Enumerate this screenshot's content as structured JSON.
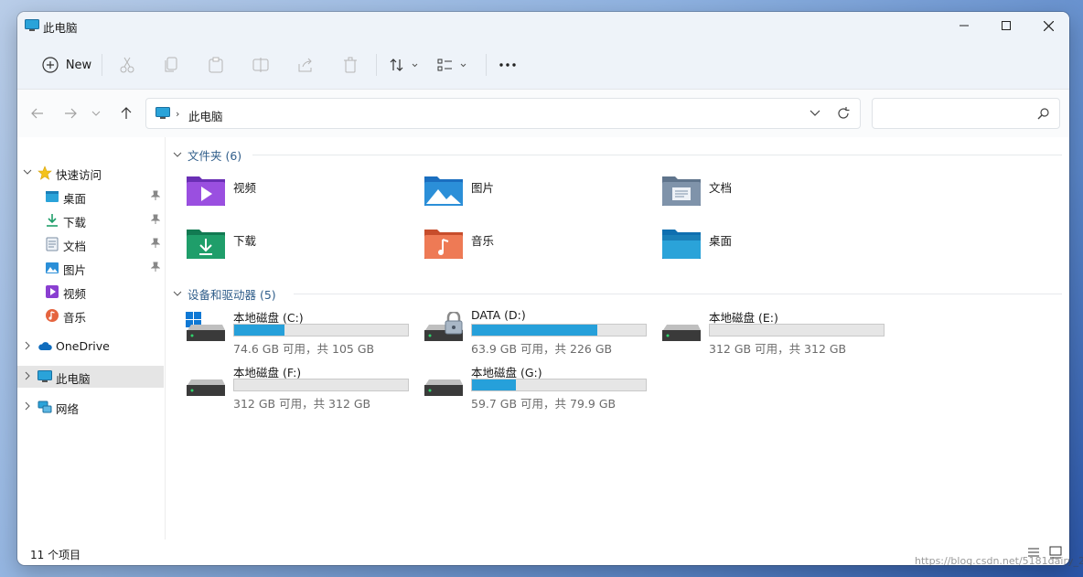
{
  "window": {
    "title": "此电脑"
  },
  "toolbar": {
    "new_label": "New"
  },
  "address": {
    "breadcrumb": "此电脑",
    "search_placeholder": ""
  },
  "sidebar": {
    "quick_access": {
      "label": "快速访问",
      "items": [
        {
          "label": "桌面",
          "icon": "desktop-folder-icon"
        },
        {
          "label": "下载",
          "icon": "download-icon"
        },
        {
          "label": "文档",
          "icon": "document-icon"
        },
        {
          "label": "图片",
          "icon": "picture-icon"
        },
        {
          "label": "视频",
          "icon": "video-icon"
        },
        {
          "label": "音乐",
          "icon": "music-icon"
        }
      ]
    },
    "onedrive": "OneDrive",
    "this_pc": "此电脑",
    "network": "网络"
  },
  "content": {
    "folders_header": "文件夹 (6)",
    "folders": [
      {
        "label": "视频"
      },
      {
        "label": "图片"
      },
      {
        "label": "文档"
      },
      {
        "label": "下载"
      },
      {
        "label": "音乐"
      },
      {
        "label": "桌面"
      }
    ],
    "drives_header": "设备和驱动器 (5)",
    "drives": [
      {
        "name": "本地磁盘 (C:)",
        "free": "74.6 GB 可用，共 105 GB",
        "used_fraction": 0.29
      },
      {
        "name": "DATA (D:)",
        "free": "63.9 GB 可用，共 226 GB",
        "used_fraction": 0.72
      },
      {
        "name": "本地磁盘 (E:)",
        "free": "312 GB 可用，共 312 GB",
        "used_fraction": 0.0
      },
      {
        "name": "本地磁盘 (F:)",
        "free": "312 GB 可用，共 312 GB",
        "used_fraction": 0.0
      },
      {
        "name": "本地磁盘 (G:)",
        "free": "59.7 GB 可用，共 79.9 GB",
        "used_fraction": 0.25
      }
    ]
  },
  "status": {
    "item_count": "11 个项目"
  },
  "watermark": "https://blog.csdn.net/5181dairy_26",
  "colors": {
    "accent": "#26a0da",
    "section_header": "#2f5d8a"
  }
}
